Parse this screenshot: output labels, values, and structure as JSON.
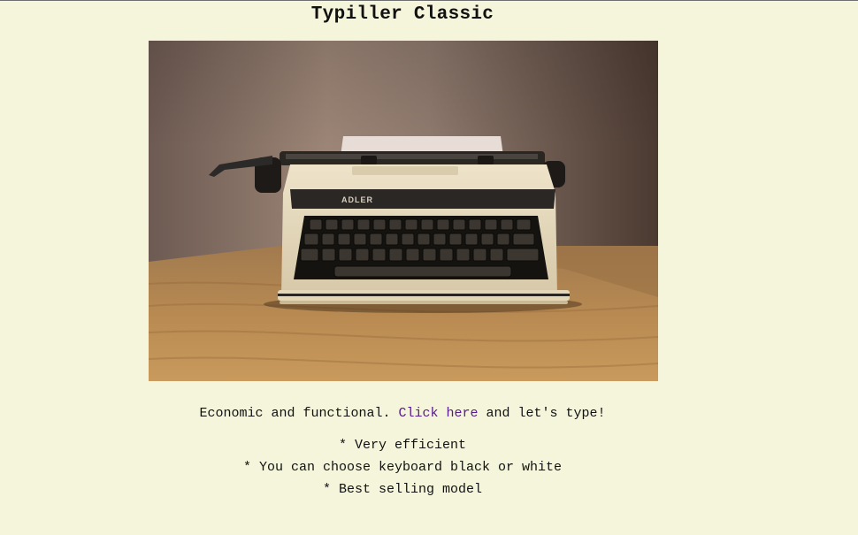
{
  "page": {
    "title": "Typiller Classic",
    "photo": {
      "subject": "typewriter-photo",
      "brand_plate_text": "ADLER"
    },
    "description": {
      "before_link": "Economic and functional.",
      "link_text": "Click here",
      "after_link": "and let's type!"
    },
    "features": [
      "* Very efficient",
      "* You can choose keyboard black or white",
      "* Best selling model"
    ],
    "colors": {
      "background": "#f5f5dc",
      "link": "#551a8b",
      "text": "#111111"
    }
  }
}
